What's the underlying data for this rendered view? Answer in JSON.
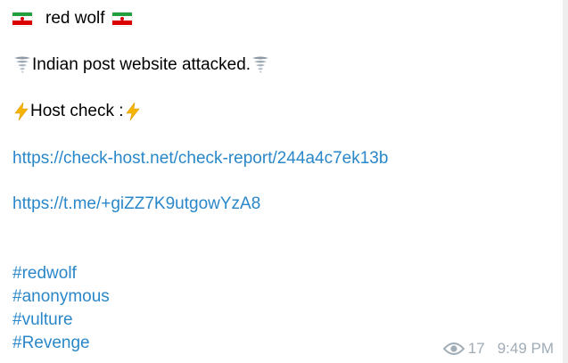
{
  "message": {
    "channel_title": "red wolf",
    "headline": "Indian post website attacked.",
    "host_check_label": "Host check :",
    "links": [
      "https://check-host.net/check-report/244a4c7ek13b",
      "https://t.me/+giZZ7K9utgowYzA8"
    ],
    "hashtags": [
      "#redwolf",
      "#anonymous",
      "#vulture",
      "#Revenge"
    ]
  },
  "meta": {
    "views": "17",
    "time": "9:49 PM"
  },
  "icons": {
    "flag": "iran-flag-icon",
    "tornado": "tornado-icon",
    "bolt": "lightning-bolt-icon",
    "views": "eye-icon"
  },
  "colors": {
    "link": "#2a87c9",
    "meta": "#a0acb6",
    "background": "#ffffff"
  }
}
